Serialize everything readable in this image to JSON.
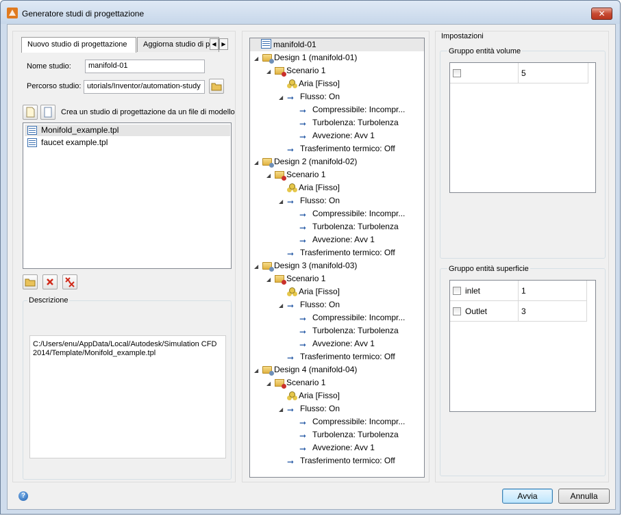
{
  "window": {
    "title": "Generatore studi di progettazione",
    "close": "✕"
  },
  "left": {
    "tabs": [
      "Nuovo studio di progettazione",
      "Aggiorna studio di p"
    ],
    "nome_label": "Nome studio:",
    "nome_value": "manifold-01",
    "percorso_label": "Percorso studio:",
    "percorso_value": "utorials/Inventor/automation-study",
    "crea_label": "Crea un studio di progettazione da un file di modello",
    "files": [
      "Monifold_example.tpl",
      "faucet example.tpl"
    ],
    "descrizione_label": "Descrizione",
    "descrizione_text": "C:/Users/enu/AppData/Local/Autodesk/Simulation CFD 2014/Template/Monifold_example.tpl"
  },
  "tree": {
    "root": "manifold-01",
    "designs": [
      {
        "label": "Design 1 (manifold-01)",
        "scenario": "Scenario 1",
        "material": "Aria [Fisso]",
        "flow": "Flusso: On",
        "flow_items": [
          "Compressibile: Incompr...",
          "Turbolenza: Turbolenza",
          "Avvezione: Avv 1"
        ],
        "heat": "Trasferimento termico: Off"
      },
      {
        "label": "Design 2 (manifold-02)",
        "scenario": "Scenario 1",
        "material": "Aria [Fisso]",
        "flow": "Flusso: On",
        "flow_items": [
          "Compressibile: Incompr...",
          "Turbolenza: Turbolenza",
          "Avvezione: Avv 1"
        ],
        "heat": "Trasferimento termico: Off"
      },
      {
        "label": "Design 3 (manifold-03)",
        "scenario": "Scenario 1",
        "material": "Aria [Fisso]",
        "flow": "Flusso: On",
        "flow_items": [
          "Compressibile: Incompr...",
          "Turbolenza: Turbolenza",
          "Avvezione: Avv 1"
        ],
        "heat": "Trasferimento termico: Off"
      },
      {
        "label": "Design 4 (manifold-04)",
        "scenario": "Scenario 1",
        "material": "Aria [Fisso]",
        "flow": "Flusso: On",
        "flow_items": [
          "Compressibile: Incompr...",
          "Turbolenza: Turbolenza",
          "Avvezione: Avv 1"
        ],
        "heat": "Trasferimento termico: Off"
      }
    ]
  },
  "settings": {
    "title": "Impostazioni",
    "volume_title": "Gruppo entità volume",
    "volume_rows": [
      {
        "name": "",
        "value": "5"
      }
    ],
    "surface_title": "Gruppo entità superficie",
    "surface_rows": [
      {
        "name": "inlet",
        "value": "1"
      },
      {
        "name": "Outlet",
        "value": "3"
      }
    ]
  },
  "footer": {
    "ok": "Avvia",
    "cancel": "Annulla",
    "help": "?"
  }
}
